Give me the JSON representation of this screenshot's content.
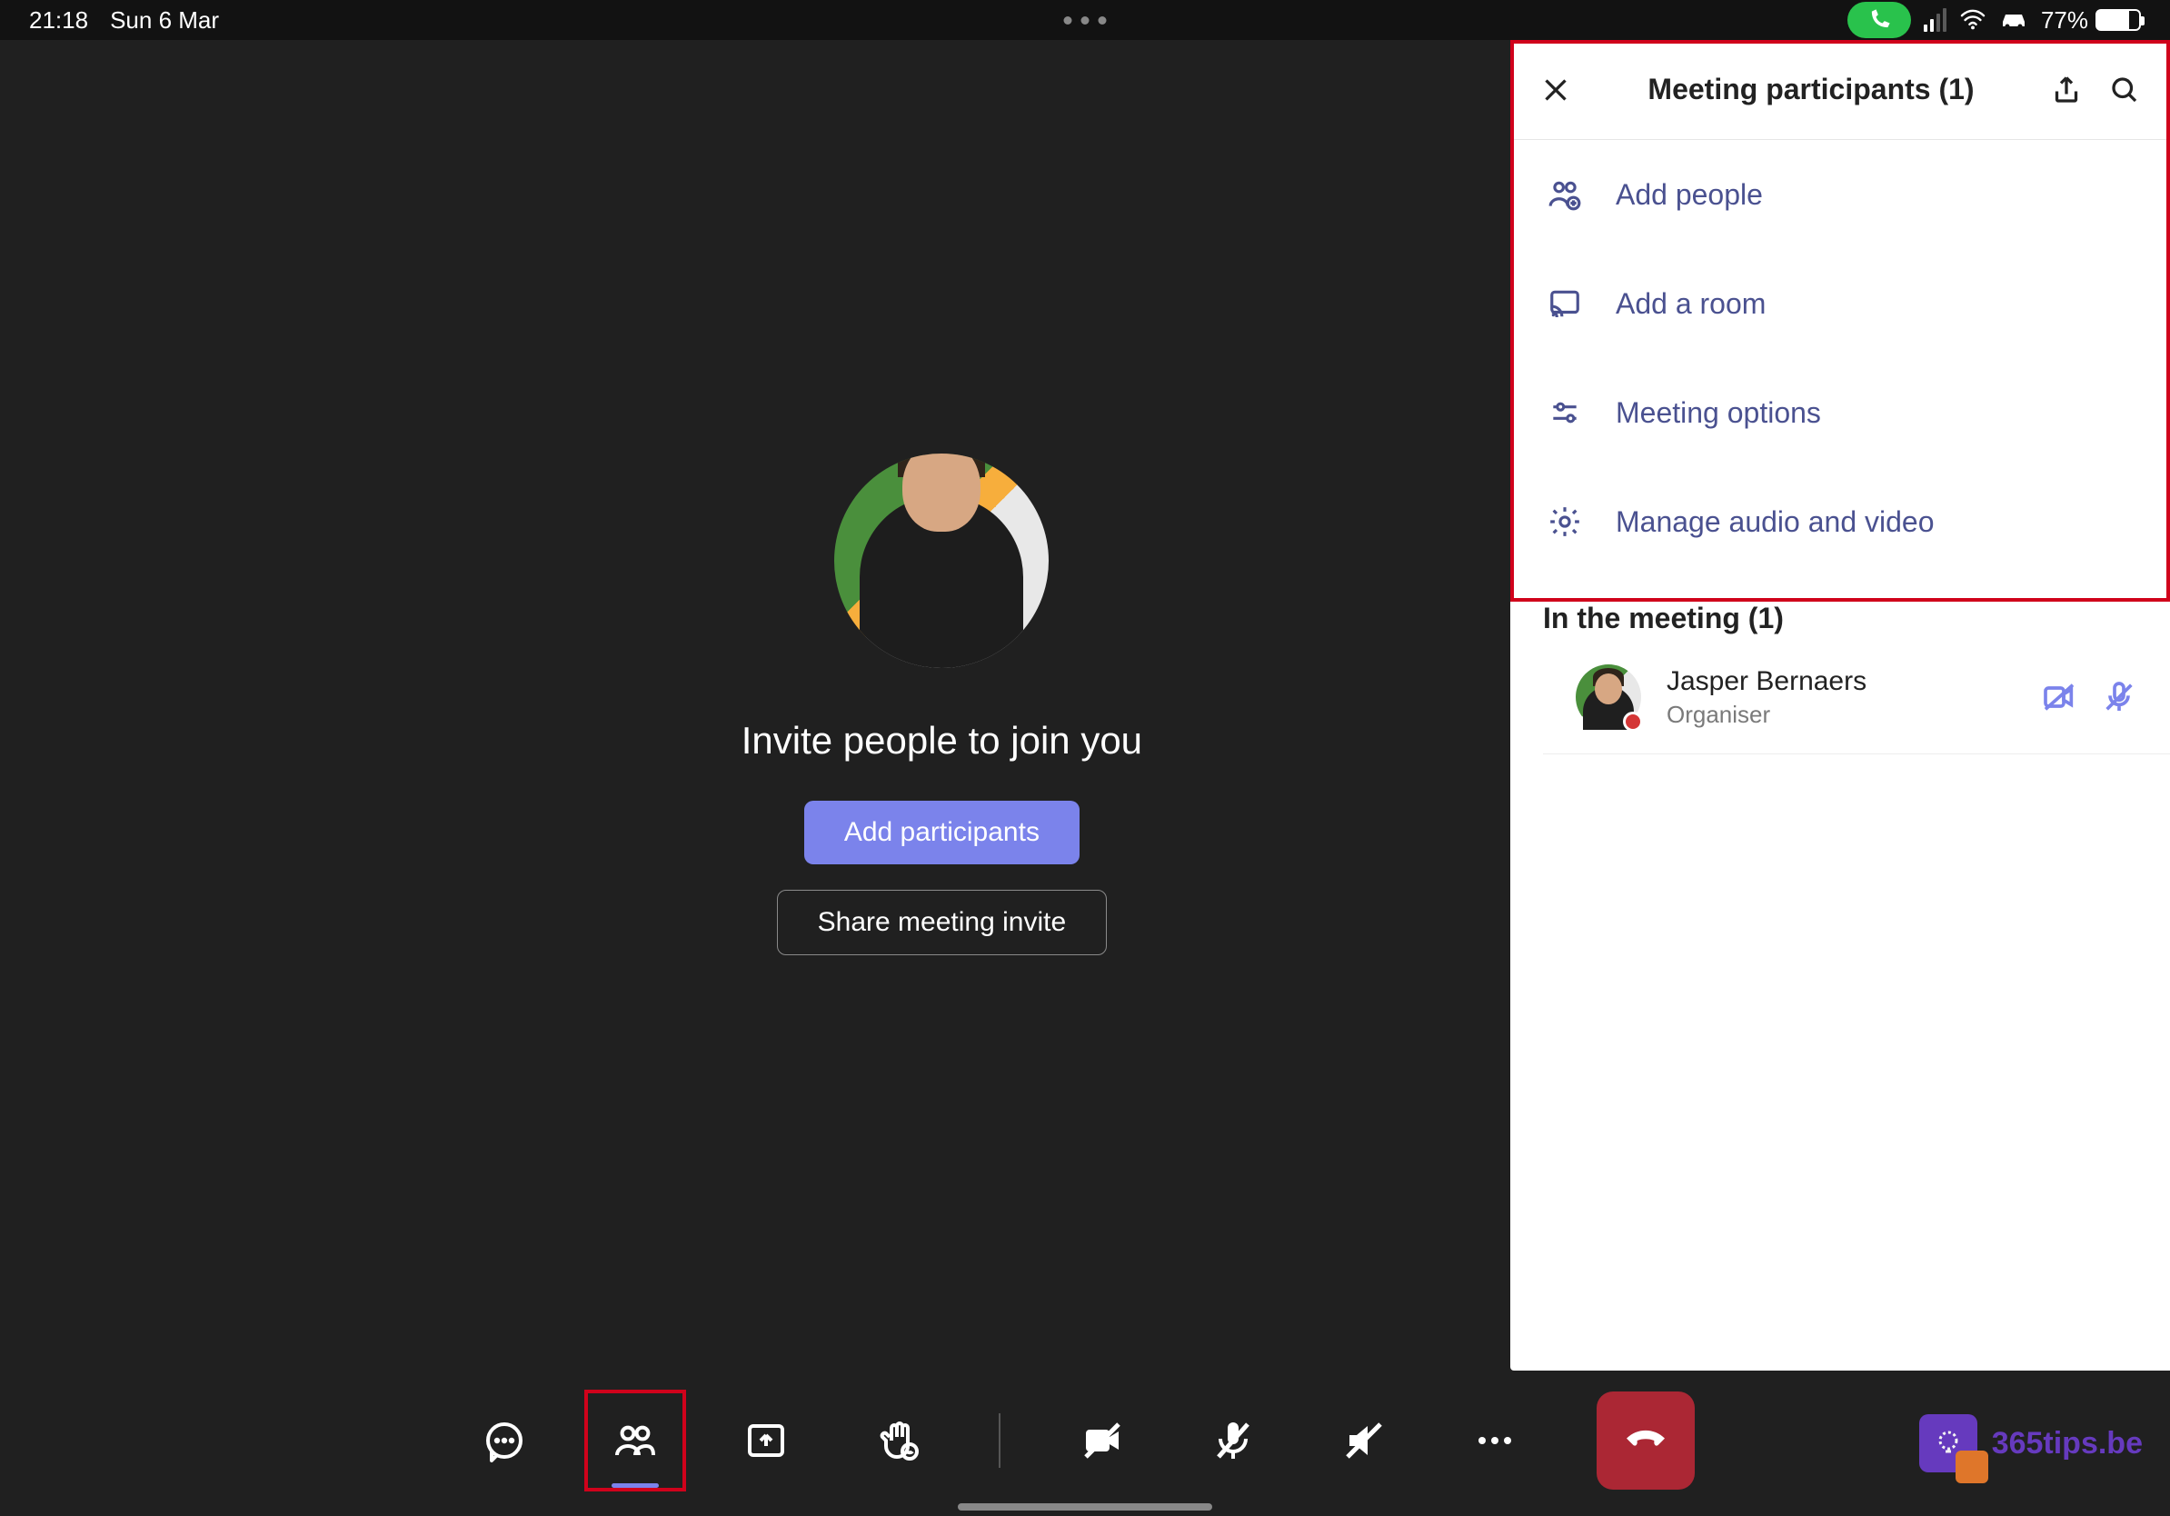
{
  "status": {
    "time": "21:18",
    "date": "Sun 6 Mar",
    "battery_pct": "77%"
  },
  "main": {
    "invite_text": "Invite people to join you",
    "add_participants_label": "Add participants",
    "share_invite_label": "Share meeting invite"
  },
  "panel": {
    "title": "Meeting participants (1)",
    "options": [
      {
        "icon": "people-add-icon",
        "label": "Add people"
      },
      {
        "icon": "cast-icon",
        "label": "Add a room"
      },
      {
        "icon": "sliders-icon",
        "label": "Meeting options"
      },
      {
        "icon": "gear-icon",
        "label": "Manage audio and video"
      }
    ],
    "section_title": "In the meeting (1)",
    "participants": [
      {
        "name": "Jasper Bernaers",
        "role": "Organiser"
      }
    ]
  },
  "watermark": {
    "text": "365tips.be"
  }
}
